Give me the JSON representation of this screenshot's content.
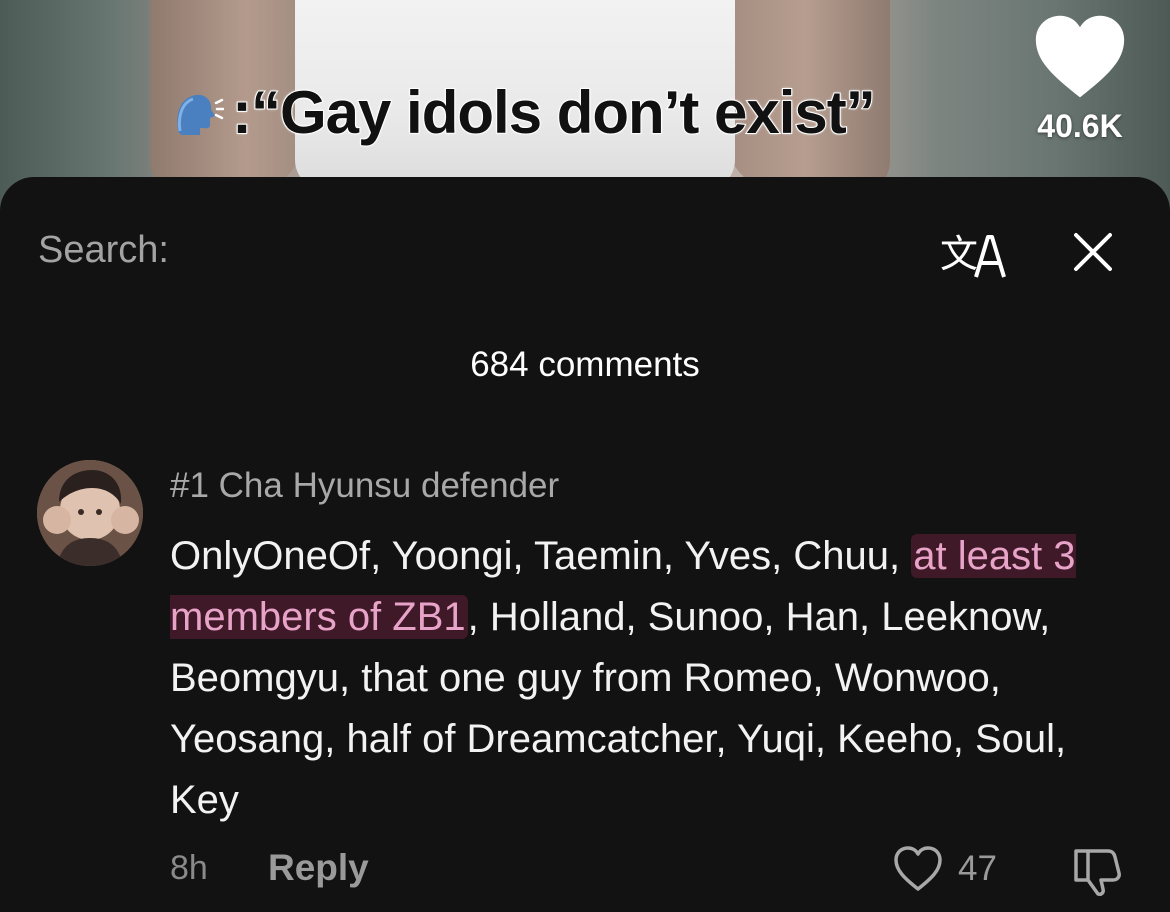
{
  "video": {
    "caption": ":“Gay idols don’t exist”",
    "caption_icon": "speaking-head-icon",
    "like_icon": "heart-icon",
    "like_count": "40.6K"
  },
  "comments_panel": {
    "search_label": "Search:",
    "translate_icon": "translate-icon",
    "close_icon": "close-icon",
    "count_label": "684 comments"
  },
  "comment": {
    "avatar_icon": "avatar",
    "username": "#1 Cha Hyunsu defender",
    "text_before": "OnlyOneOf, Yoongi, Taemin, Yves, Chuu, ",
    "text_highlight": "at least 3 members of ZB1",
    "text_after": ", Holland, Sunoo, Han, Leeknow, Beomgyu, that one guy from Romeo, Wonwoo, Yeosang, half of Dreamcatcher, Yuqi, Keeho, Soul, Key",
    "time": "8h",
    "reply_label": "Reply",
    "like_icon": "heart-outline-icon",
    "like_count": "47",
    "dislike_icon": "thumbs-down-icon"
  },
  "colors": {
    "sheet_background": "#121212",
    "highlight_text": "#e8a3c8",
    "muted_text": "#a3a3a3"
  }
}
